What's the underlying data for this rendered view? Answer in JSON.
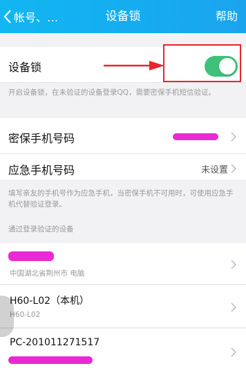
{
  "header": {
    "back_label": "帐号、…",
    "title": "设备锁",
    "help_label": "帮助"
  },
  "device_lock": {
    "label": "设备锁",
    "enabled": true,
    "hint": "开启设备锁，在未验证的设备登录QQ，需要密保手机短信验证。"
  },
  "security_phone": {
    "label": "密保手机号码"
  },
  "emergency_phone": {
    "label": "应急手机号码",
    "value": "未设置",
    "hint": "填写亲友的手机号作为应急手机，当密保手机不可用时，可使用应急手机代替验证登录。"
  },
  "verified_devices": {
    "section_label": "通过登录验证的设备",
    "items": [
      {
        "name": "",
        "sub": "中国湖北省荆州市 电脑"
      },
      {
        "name": "H60-L02（本机）",
        "sub": "H60-L02"
      },
      {
        "name": "PC-201011271517",
        "sub": ""
      }
    ]
  },
  "colors": {
    "header_bg": "#1aa4ee",
    "toggle_on": "#3ec27a",
    "highlight_red": "#e8262b",
    "redaction": "#e81fd2"
  },
  "icons": {
    "back": "chevron-left-icon",
    "row_arrow": "chevron-right-icon",
    "annotation": "red-arrow-icon"
  }
}
